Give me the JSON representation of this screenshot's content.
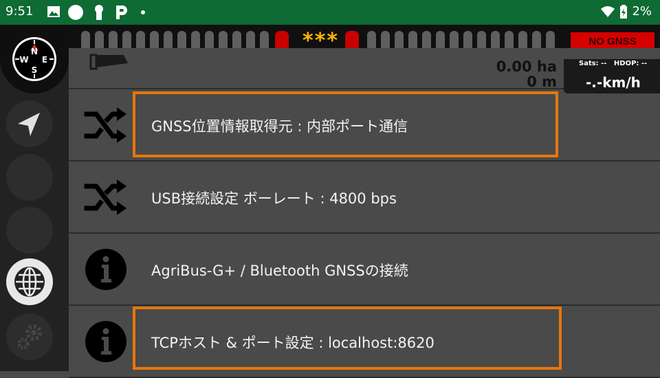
{
  "status_bar": {
    "time": "9:51",
    "battery": "2%"
  },
  "top_bar": {
    "center_text": "***",
    "gnss_status": "NO GNSS"
  },
  "gnss_info": {
    "sats": "Sats: --",
    "hdop": "HDOP: --",
    "speed": "-.-km/h"
  },
  "work_info": {
    "area": "0.00 ha",
    "distance": "0 m"
  },
  "settings": [
    {
      "label": "GNSS位置情報取得元 : 内部ポート通信",
      "icon": "shuffle-icon"
    },
    {
      "label": "USB接続設定 ボーレート : 4800 bps",
      "icon": "shuffle-icon"
    },
    {
      "label": "AgriBus-G+ / Bluetooth GNSSの接続",
      "icon": "info-icon"
    },
    {
      "label": "TCPホスト & ポート設定 : localhost:8620",
      "icon": "info-icon"
    }
  ],
  "colors": {
    "status_bar": "#0e6b34",
    "highlight": "#e8760b",
    "no_gnss_bg": "#d50000",
    "stars": "#ffb300"
  }
}
